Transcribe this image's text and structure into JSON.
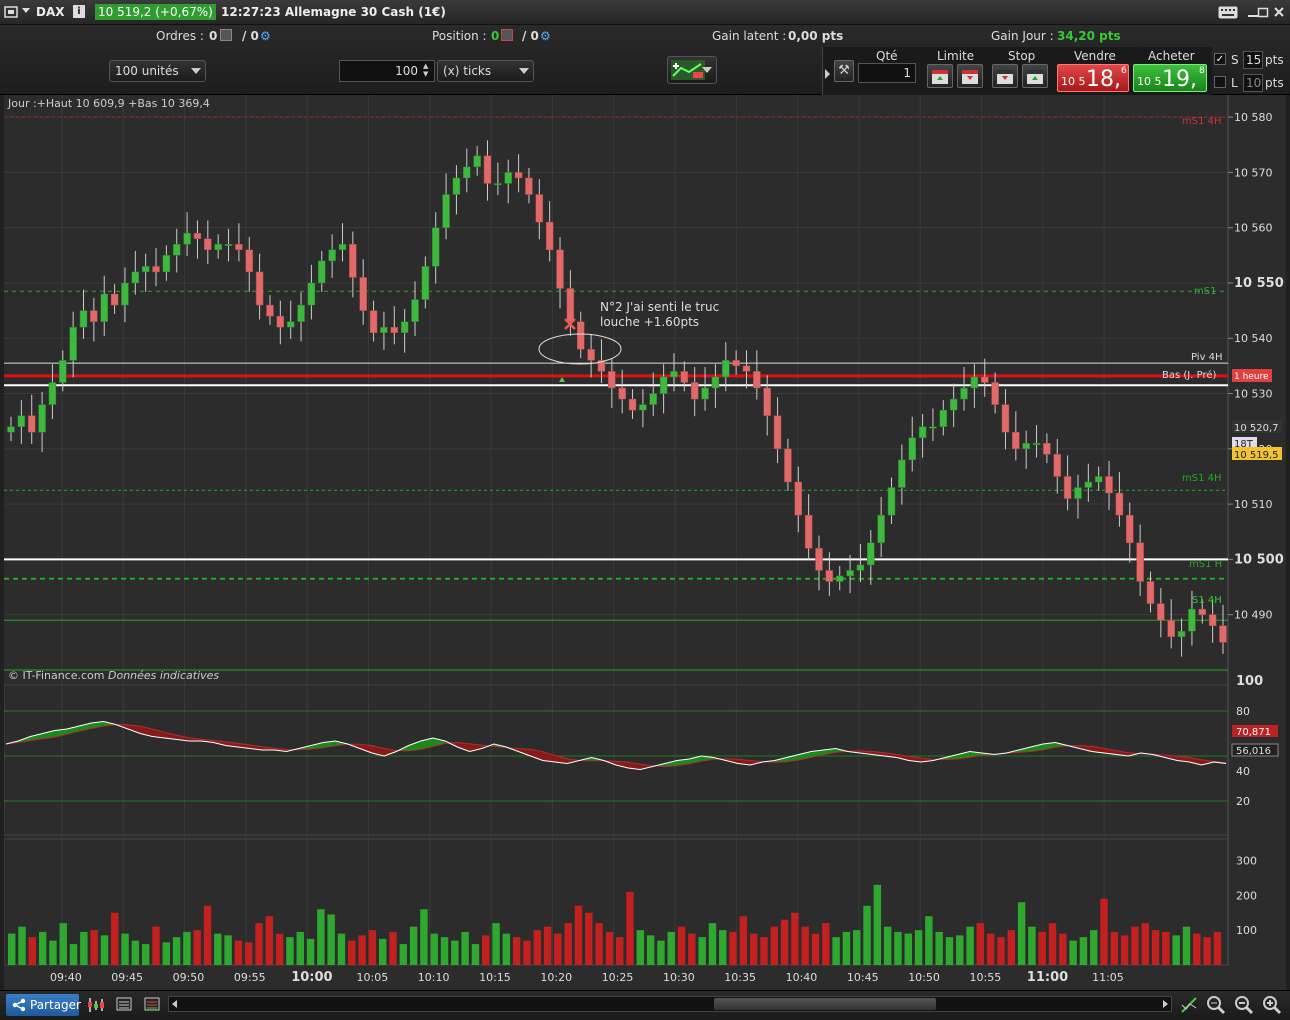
{
  "window": {
    "symbol": "DAX",
    "price_change": "10 519,2 (+0,67%)",
    "title": "12:27:23 Allemagne 30 Cash (1€)"
  },
  "toolbar": {
    "orders_label": "Ordres :",
    "orders_count": "0",
    "orders_count2": "/ 0",
    "position_label": "Position :",
    "position_count": "0",
    "position_count2": "/ 0",
    "unrealized_label": "Gain latent :",
    "unrealized_value": "0,00 pts",
    "daily_gain_label": "Gain Jour :",
    "daily_gain_value": "34,20 pts",
    "units_select": "100 unités",
    "ticks_value": "100",
    "ticks_select": "(x) ticks"
  },
  "trade": {
    "qty_label": "Qté",
    "qty_value": "1",
    "limit_label": "Limite",
    "stop_label": "Stop",
    "sell_label": "Vendre",
    "buy_label": "Acheter",
    "sell_prefix": "10 5",
    "sell_big": "18,",
    "sell_sup": "6",
    "buy_prefix": "10 5",
    "buy_big": "19,",
    "buy_sup": "8",
    "s_label": "S",
    "s_value": "15",
    "s_unit": "pts",
    "l_label": "L",
    "l_value": "10",
    "l_unit": "pts"
  },
  "chart": {
    "info": "Jour :+Haut 10 609,9 +Bas 10 369,4",
    "copyright": "© IT-Finance.com",
    "copyright_note": "Données indicatives",
    "annotation_line1": "N°2 J'ai senti le truc",
    "annotation_line2": "louche +1.60pts",
    "level_labels": {
      "ms1_4h_top": "mS1 4H",
      "ms1": "mS1",
      "piv_4h": "Piv 4H",
      "bas": "Bas (J. Pré)",
      "hour": "1 heure",
      "ms1_4h": "mS1 4H",
      "ms1_h": "mS1 H",
      "s1_4h": "S1 4H"
    },
    "price_ticks": [
      "10 580",
      "10 570",
      "10 560",
      "10 550",
      "10 540",
      "10 530",
      "10 520",
      "10 510",
      "10 500",
      "10 490"
    ],
    "price_markers": {
      "high_label": "10 520,7",
      "tag": "18T",
      "current": "10 519,5"
    },
    "osc_ticks": [
      "100",
      "80",
      "40",
      "20"
    ],
    "osc_values": [
      "70,871",
      "56,016"
    ],
    "vol_ticks": [
      "300",
      "200",
      "100"
    ],
    "time_ticks": [
      "09:40",
      "09:45",
      "09:50",
      "09:55",
      "10:00",
      "10:05",
      "10:10",
      "10:15",
      "10:20",
      "10:25",
      "10:30",
      "10:35",
      "10:40",
      "10:45",
      "10:50",
      "10:55",
      "11:00",
      "11:05"
    ],
    "colors": {
      "up": "#3fb83f",
      "down": "#e06a6a",
      "bg": "#2c2c2c"
    }
  },
  "chart_data": {
    "type": "candlestick",
    "price_range": [
      10478,
      10584
    ],
    "osc_range": [
      0,
      100
    ],
    "volume_range": [
      0,
      350
    ],
    "closes": [
      10524,
      10526,
      10523,
      10528,
      10532,
      10536,
      10542,
      10545,
      10543,
      10548,
      10546,
      10550,
      10552,
      10553,
      10552,
      10555,
      10557,
      10559,
      10558,
      10556,
      10557,
      10557,
      10556,
      10552,
      10546,
      10544,
      10542,
      10543,
      10546,
      10550,
      10554,
      10556,
      10557,
      10551,
      10545,
      10541,
      10542,
      10541,
      10543,
      10547,
      10553,
      10560,
      10566,
      10569,
      10571,
      10573,
      10568,
      10568,
      10570,
      10569,
      10566,
      10561,
      10556,
      10549,
      10543,
      10538,
      10536,
      10534,
      10531,
      10529,
      10527,
      10528,
      10530,
      10533,
      10534,
      10532,
      10529,
      10531,
      10533,
      10536,
      10535,
      10534,
      10531,
      10526,
      10520,
      10514,
      10508,
      10502,
      10498,
      10496,
      10497,
      10498,
      10499,
      10503,
      10508,
      10513,
      10518,
      10522,
      10524,
      10524,
      10527,
      10529,
      10531,
      10533,
      10532,
      10528,
      10523,
      10520,
      10521,
      10521,
      10519,
      10515,
      10511,
      10513,
      10514,
      10515,
      10512,
      10508,
      10503,
      10496,
      10492,
      10489,
      10486,
      10487,
      10491,
      10490,
      10488,
      10485
    ],
    "rsi": [
      58,
      60,
      63,
      65,
      67,
      68,
      70,
      72,
      73,
      71,
      68,
      65,
      63,
      62,
      61,
      60,
      60,
      59,
      57,
      56,
      55,
      54,
      54,
      53,
      55,
      57,
      59,
      60,
      58,
      55,
      52,
      50,
      53,
      57,
      60,
      62,
      60,
      56,
      53,
      55,
      58,
      56,
      53,
      50,
      47,
      46,
      45,
      47,
      49,
      47,
      44,
      42,
      41,
      43,
      45,
      47,
      48,
      50,
      49,
      47,
      45,
      44,
      46,
      47,
      49,
      51,
      53,
      54,
      55,
      53,
      52,
      51,
      50,
      49,
      47,
      46,
      47,
      49,
      51,
      53,
      52,
      51,
      52,
      54,
      56,
      58,
      59,
      57,
      55,
      53,
      52,
      51,
      50,
      52,
      51,
      49,
      47,
      46,
      44,
      46,
      45
    ],
    "volumes": [
      90,
      110,
      80,
      95,
      70,
      120,
      60,
      95,
      100,
      85,
      150,
      90,
      70,
      60,
      110,
      65,
      80,
      95,
      100,
      170,
      90,
      85,
      70,
      65,
      120,
      140,
      90,
      80,
      95,
      75,
      160,
      145,
      90,
      70,
      85,
      100,
      75,
      95,
      60,
      110,
      160,
      90,
      80,
      70,
      95,
      60,
      85,
      120,
      90,
      80,
      70,
      100,
      110,
      90,
      120,
      170,
      150,
      120,
      95,
      80,
      210,
      100,
      85,
      70,
      95,
      110,
      90,
      80,
      120,
      100,
      95,
      140,
      90,
      80,
      110,
      130,
      150,
      110,
      90,
      120,
      80,
      95,
      100,
      170,
      230,
      110,
      95,
      90,
      100,
      140,
      95,
      80,
      85,
      110,
      120,
      90,
      80,
      100,
      180,
      110,
      95,
      120,
      90,
      70,
      80,
      100,
      190,
      95,
      85,
      110,
      120,
      100,
      95,
      85,
      110,
      90,
      80,
      95
    ]
  }
}
